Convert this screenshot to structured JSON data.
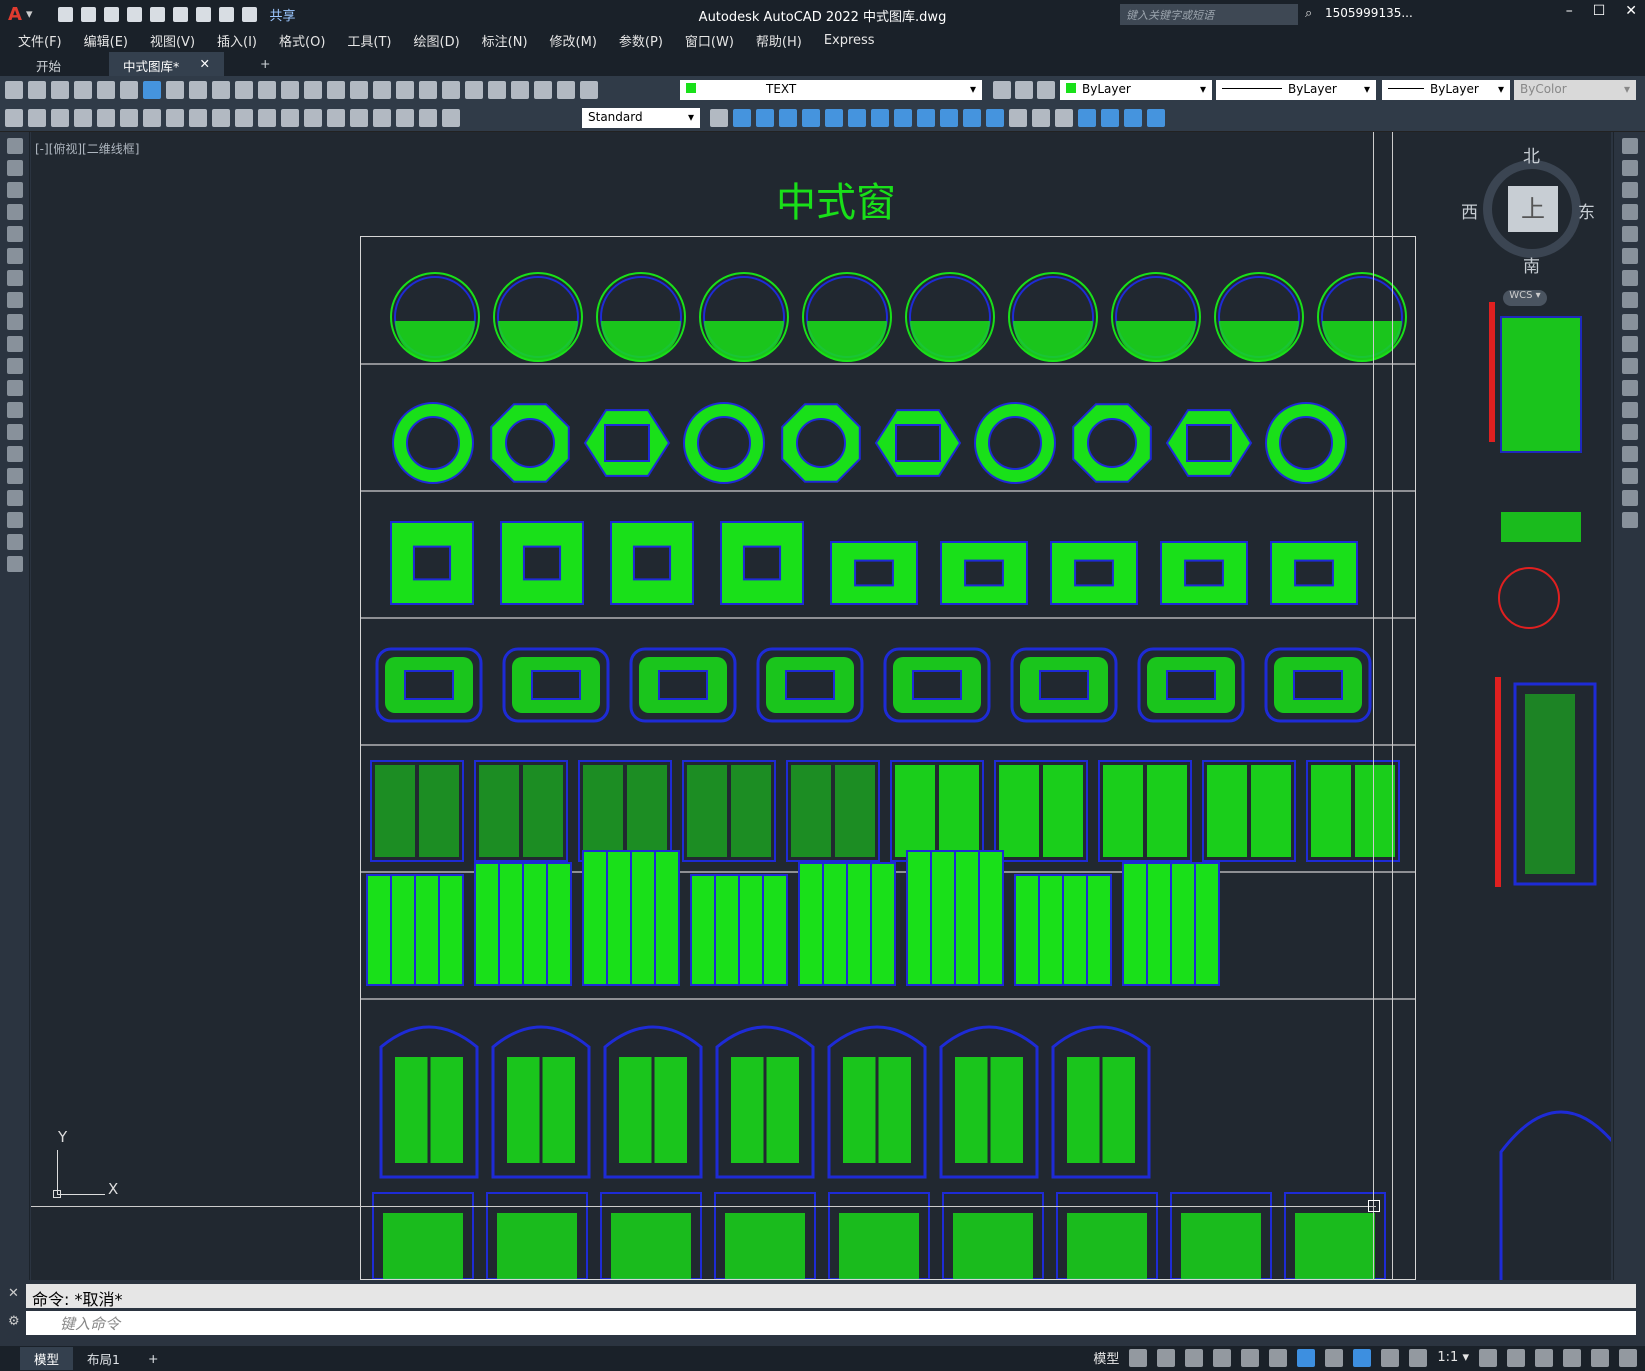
{
  "app": {
    "title": "Autodesk AutoCAD 2022    中式图库.dwg",
    "logo": "A",
    "share": "共享",
    "search_placeholder": "键入关键字或短语",
    "user": "1505999135...",
    "window_controls": [
      "–",
      "☐",
      "✕"
    ]
  },
  "menu": [
    "文件(F)",
    "编辑(E)",
    "视图(V)",
    "插入(I)",
    "格式(O)",
    "工具(T)",
    "绘图(D)",
    "标注(N)",
    "修改(M)",
    "参数(P)",
    "窗口(W)",
    "帮助(H)",
    "Express"
  ],
  "tabs": [
    {
      "label": "开始"
    },
    {
      "label": "中式图库*"
    },
    {
      "label": "+"
    }
  ],
  "toolbar": {
    "layer": "TEXT",
    "color": "ByLayer",
    "linetype": "ByLayer",
    "lineweight": "ByLayer",
    "plotstyle": "ByColor",
    "textstyle": "Standard"
  },
  "viewport": {
    "label": "[-][俯视][二维线框]",
    "drawing_title": "中式窗"
  },
  "viewcube": {
    "north": "北",
    "south": "南",
    "east": "东",
    "west": "西",
    "face": "上",
    "wcs": "WCS ▾"
  },
  "ucs": {
    "x": "X",
    "y": "Y"
  },
  "command": {
    "history": "命令: *取消*",
    "placeholder": "键入命令"
  },
  "statusbar": {
    "tabs": [
      "模型",
      "布局1",
      "+"
    ],
    "model_label": "模型",
    "scale": "1:1 ▾"
  },
  "colors": {
    "drawing_green": "#19e019",
    "drawing_blue": "#1e2bd6",
    "background": "#212830"
  }
}
